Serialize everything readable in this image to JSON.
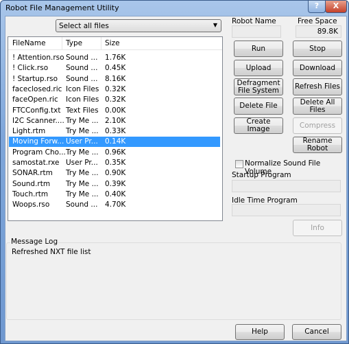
{
  "window": {
    "title": "Robot File Management Utility",
    "help_button": "?",
    "close_button": "X"
  },
  "filter": {
    "selected": "Select all files"
  },
  "file_list": {
    "columns": [
      "FileName",
      "Type",
      "Size"
    ],
    "rows": [
      [
        "! Attention.rso",
        "Sound ...",
        "1.76K"
      ],
      [
        "! Click.rso",
        "Sound ...",
        "0.45K"
      ],
      [
        "! Startup.rso",
        "Sound ...",
        "8.16K"
      ],
      [
        "faceclosed.ric",
        "Icon Files",
        "0.32K"
      ],
      [
        "faceOpen.ric",
        "Icon Files",
        "0.32K"
      ],
      [
        "FTCConfig.txt",
        "Text Files",
        "0.00K"
      ],
      [
        "I2C Scanner....",
        "Try Me ...",
        "2.10K"
      ],
      [
        "Light.rtm",
        "Try Me ...",
        "0.33K"
      ],
      [
        "Moving Forw...",
        "User Pr...",
        "0.14K"
      ],
      [
        "Program Cho...",
        "Try Me ...",
        "0.96K"
      ],
      [
        "samostat.rxe",
        "User Pr...",
        "0.35K"
      ],
      [
        "SONAR.rtm",
        "Try Me ...",
        "0.90K"
      ],
      [
        "Sound.rtm",
        "Try Me ...",
        "0.39K"
      ],
      [
        "Touch.rtm",
        "Try Me ...",
        "0.40K"
      ],
      [
        "Woops.rso",
        "Sound ...",
        "4.70K"
      ]
    ],
    "selected_index": 8
  },
  "robot": {
    "name_label": "Robot Name",
    "name_value": "",
    "free_space_label": "Free Space",
    "free_space_value": "89.8K"
  },
  "buttons": {
    "run": "Run",
    "stop": "Stop",
    "upload": "Upload",
    "download": "Download",
    "defragment": "Defragment File System",
    "refresh": "Refresh Files",
    "delete_file": "Delete File",
    "delete_all": "Delete All Files",
    "create_image": "Create Image",
    "compress": "Compress",
    "rename": "Rename Robot",
    "info": "Info",
    "help": "Help",
    "cancel": "Cancel"
  },
  "options": {
    "normalize_label": "Normalize Sound File Volume",
    "normalize_checked": false,
    "startup_label": "Startup Program",
    "startup_value": "",
    "idle_label": "Idle Time Program",
    "idle_value": ""
  },
  "message_log": {
    "label": "Message Log",
    "messages": [
      "Refreshed NXT file list"
    ]
  }
}
